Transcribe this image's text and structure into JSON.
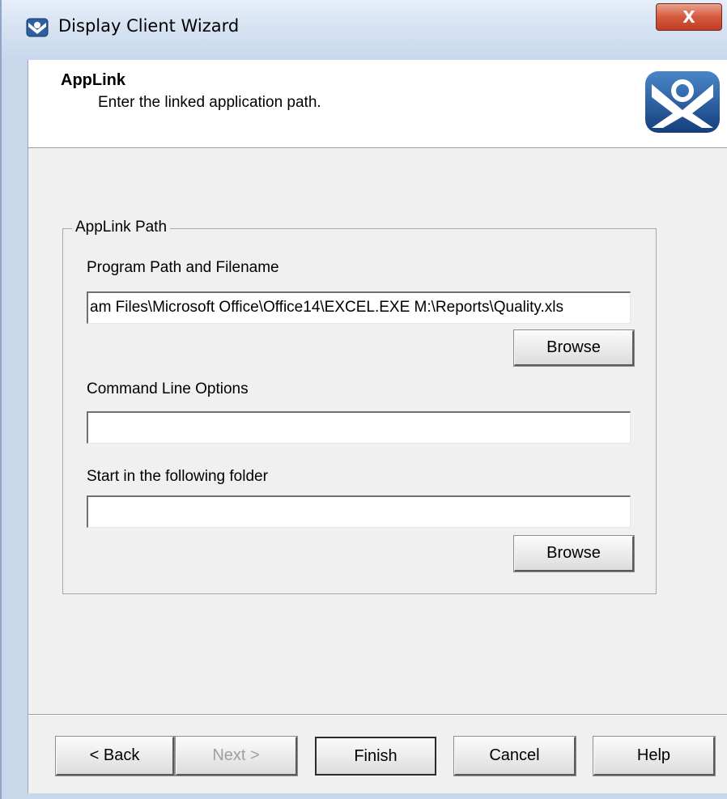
{
  "window": {
    "title": "Display Client Wizard",
    "close_label": "X"
  },
  "header": {
    "title": "AppLink",
    "subtitle": "Enter the linked application path."
  },
  "groupbox": {
    "label": "AppLink Path",
    "program_path_label": "Program Path and Filename",
    "program_path_value": "am Files\\Microsoft Office\\Office14\\EXCEL.EXE M:\\Reports\\Quality.xls",
    "browse_label_1": "Browse",
    "command_line_label": "Command Line Options",
    "command_line_value": "",
    "start_folder_label": "Start in the following folder",
    "start_folder_value": "",
    "browse_label_2": "Browse"
  },
  "footer": {
    "back_label": "< Back",
    "next_label": "Next >",
    "finish_label": "Finish",
    "cancel_label": "Cancel",
    "help_label": "Help"
  },
  "colors": {
    "title_bar": "#d7e3f3",
    "close_button": "#d4593f",
    "logo_blue": "#1f4c8c",
    "dialog_background": "#f0f0f0"
  },
  "icons": [
    "wizard-app-icon",
    "close-icon",
    "applink-logo"
  ]
}
